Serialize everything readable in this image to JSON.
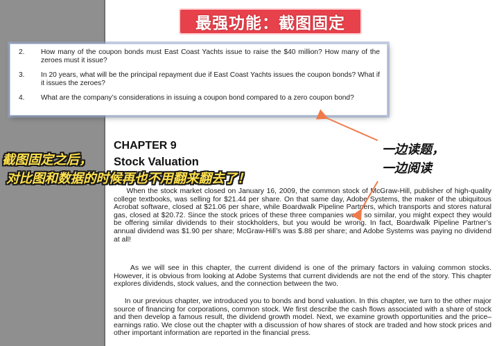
{
  "banner": {
    "text": "最强功能：截图固定"
  },
  "pinned": {
    "questions": [
      {
        "num": "2.",
        "text": "How many of the coupon bonds must East Coast Yachts issue to raise the $40 million? How many of the zeroes must it issue?"
      },
      {
        "num": "3.",
        "text": "In 20 years, what will be the principal repayment due if East Coast Yachts issues the coupon bonds? What if it issues the zeroes?"
      },
      {
        "num": "4.",
        "text": "What are the company’s considerations in issuing a coupon bond compared to a zero coupon bond?"
      }
    ]
  },
  "chapter": {
    "number": "CHAPTER 9",
    "title": "Stock Valuation"
  },
  "paragraphs": {
    "p1": "When the stock market closed on January 16, 2009, the common stock of McGraw-Hill, publisher of high-quality college textbooks, was selling for $21.44 per share. On that same day, Adobe Systems, the maker of the ubiquitous Acrobat software, closed at $21.06 per share, while Boardwalk Pipeline Partners, which transports and stores natural gas, closed at $20.72. Since the stock prices of these three companies were so similar, you might expect they would be offering similar dividends to their stockholders, but you would be wrong. In fact, Boardwalk Pipeline Partner’s annual dividend was $1.90 per share; McGraw-Hill’s was $.88 per share; and Adobe Systems was paying no dividend at all!",
    "p2": "As we will see in this chapter, the current dividend is one of the primary factors in valuing common stocks. However, it is obvious from looking at Adobe Systems that current dividends are not the end of the story. This chapter explores dividends, stock values, and the connection between the two.",
    "p3": "In our previous chapter, we introduced you to bonds and bond valuation. In this chapter, we turn to the other major source of financing for corporations, common stock. We first describe the cash flows associated with a share of stock and then develop a famous result, the dividend growth model. Next, we examine growth opportunities and the price–earnings ratio. We close out the chapter with a discussion of how shares of stock are traded and how stock prices and other important information are reported in the financial press."
  },
  "annotations": {
    "left_line1": "截图固定之后，",
    "left_line2": "对比图和数据的时候再也不用翻来翻去了！",
    "right_line1": "一边读题，",
    "right_line2": "一边阅读"
  },
  "colors": {
    "banner_bg": "#e7424c",
    "annotation_yellow": "#ffe14d",
    "arrow": "#f07a4a"
  }
}
